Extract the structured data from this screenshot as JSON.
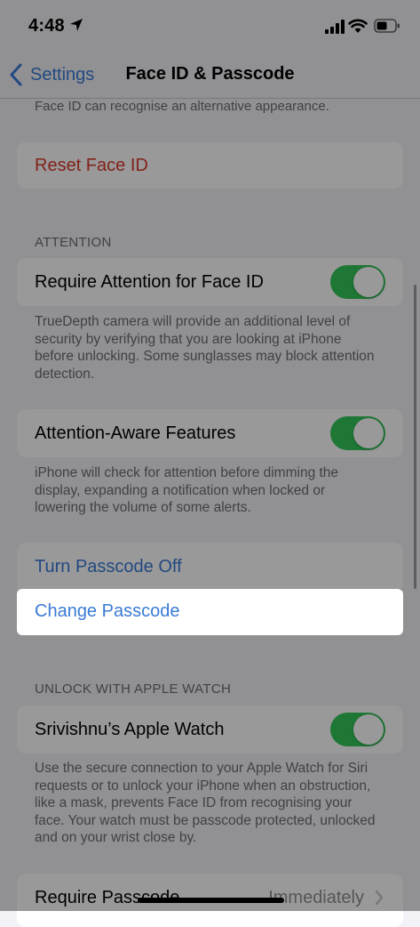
{
  "status": {
    "time": "4:48"
  },
  "nav": {
    "back_label": "Settings",
    "title": "Face ID & Passcode"
  },
  "top_text": "Face ID can recognise an alternative appearance.",
  "reset": {
    "label": "Reset Face ID"
  },
  "attention": {
    "header": "ATTENTION",
    "require_label": "Require Attention for Face ID",
    "require_footer": "TrueDepth camera will provide an additional level of security by verifying that you are looking at iPhone before unlocking. Some sunglasses may block attention detection.",
    "aware_label": "Attention-Aware Features",
    "aware_footer": "iPhone will check for attention before dimming the display, expanding a notification when locked or lowering the volume of some alerts."
  },
  "passcode": {
    "turn_off_label": "Turn Passcode Off",
    "change_label": "Change Passcode"
  },
  "watch": {
    "header": "UNLOCK WITH APPLE WATCH",
    "watch_label": "Srivishnu’s Apple Watch",
    "footer": "Use the secure connection to your Apple Watch for Siri requests or to unlock your iPhone when an obstruction, like a mask, prevents Face ID from recognising your face. Your watch must be passcode protected, unlocked and on your wrist close by."
  },
  "require_passcode": {
    "label": "Require Passcode",
    "value": "Immediately"
  },
  "colors": {
    "accent": "#3a7bd5",
    "destructive": "#d93a2b",
    "toggle_on": "#34c759"
  },
  "icons": {
    "back": "chevron-left-icon",
    "location": "location-arrow-icon",
    "signal": "cellular-signal-icon",
    "wifi": "wifi-icon",
    "battery": "battery-icon",
    "disclosure": "chevron-right-icon"
  }
}
